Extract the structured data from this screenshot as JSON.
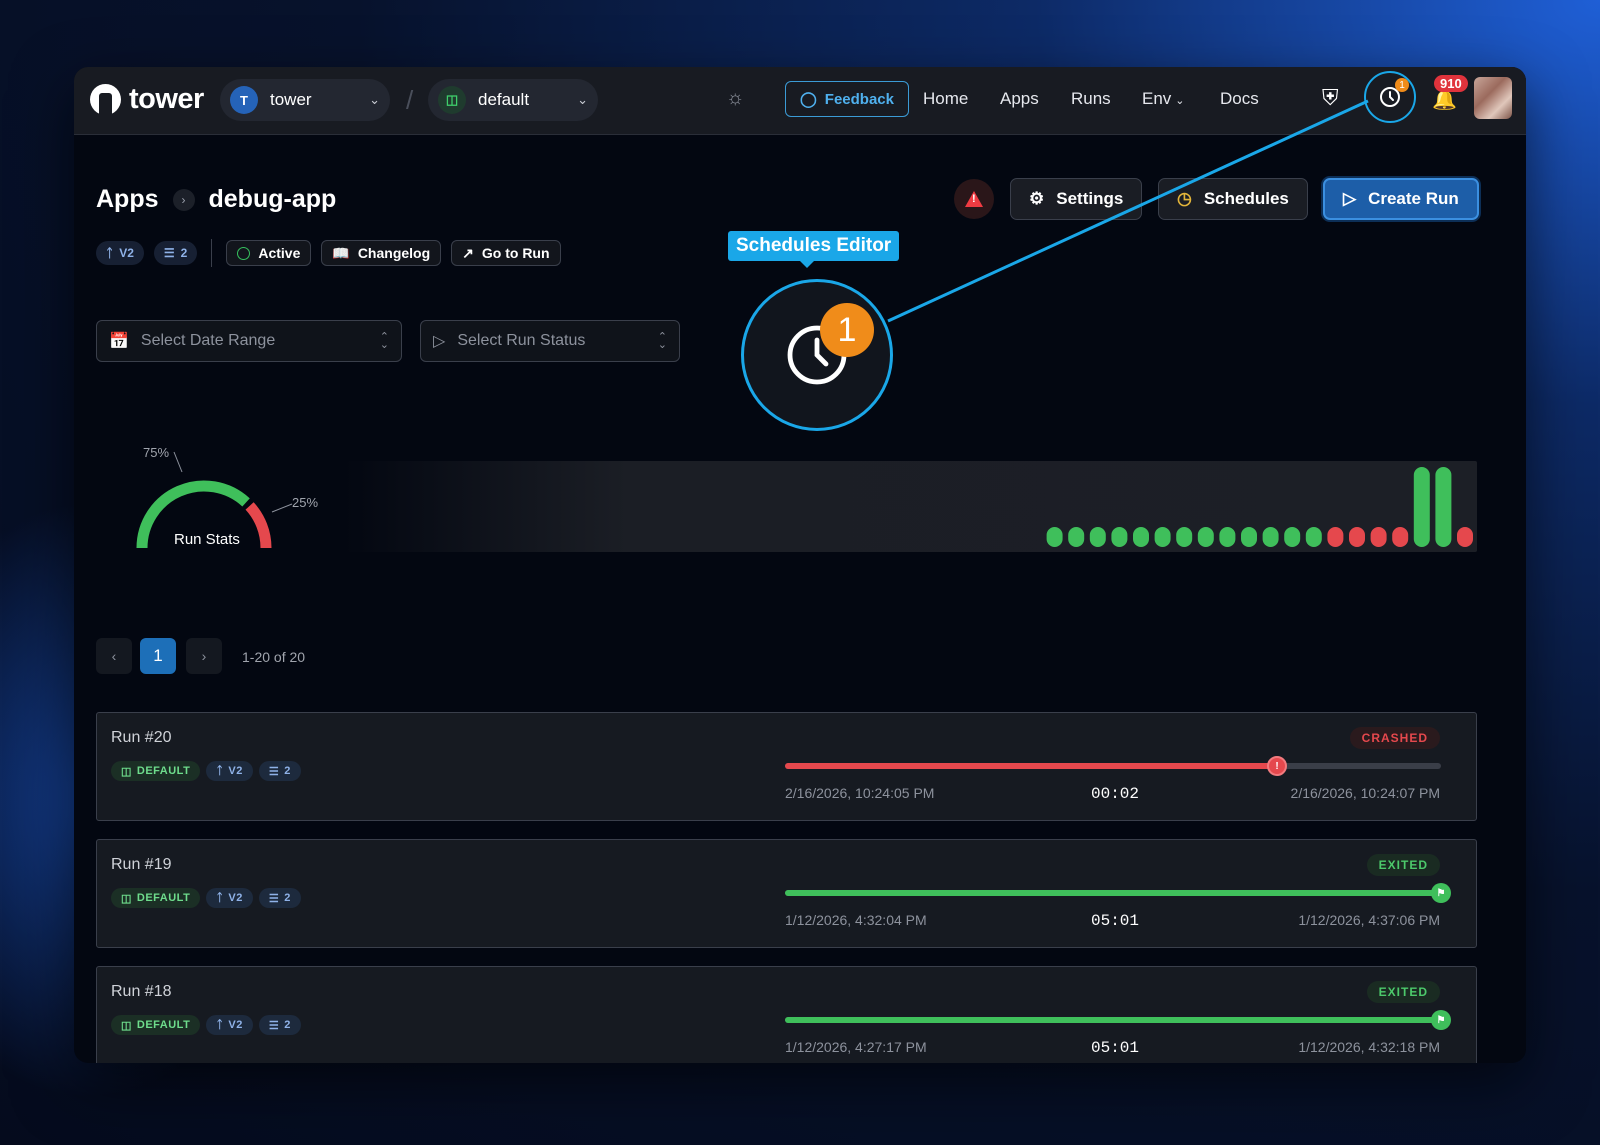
{
  "topbar": {
    "logo_text": "tower",
    "org": {
      "initial": "T",
      "label": "tower"
    },
    "env": {
      "label": "default"
    },
    "feedback_label": "Feedback",
    "nav": [
      {
        "label": "Home"
      },
      {
        "label": "Apps"
      },
      {
        "label": "Runs"
      },
      {
        "label": "Env",
        "has_dropdown": true
      },
      {
        "label": "Docs"
      }
    ],
    "schedules_badge": "1",
    "notifications_count": "910"
  },
  "header": {
    "breadcrumb_root": "Apps",
    "app_name": "debug-app",
    "buttons": {
      "settings": "Settings",
      "schedules": "Schedules",
      "create_run": "Create Run"
    },
    "tags": {
      "version": "V2",
      "params": "2",
      "status": "Active",
      "changelog": "Changelog",
      "go_to_run": "Go to Run"
    }
  },
  "callout": {
    "tooltip": "Schedules Editor",
    "badge": "1"
  },
  "filters": {
    "date_range": "Select Date Range",
    "run_status": "Select Run Status"
  },
  "stats": {
    "title": "Run Stats",
    "success_label": "75%",
    "failure_label": "25%",
    "success_fraction": 0.75,
    "histogram": [
      {
        "status": "success",
        "level": 0.25
      },
      {
        "status": "success",
        "level": 0.25
      },
      {
        "status": "success",
        "level": 0.25
      },
      {
        "status": "success",
        "level": 0.25
      },
      {
        "status": "success",
        "level": 0.25
      },
      {
        "status": "success",
        "level": 0.25
      },
      {
        "status": "success",
        "level": 0.25
      },
      {
        "status": "success",
        "level": 0.25
      },
      {
        "status": "success",
        "level": 0.25
      },
      {
        "status": "success",
        "level": 0.25
      },
      {
        "status": "success",
        "level": 0.25
      },
      {
        "status": "success",
        "level": 0.25
      },
      {
        "status": "success",
        "level": 0.25
      },
      {
        "status": "failure",
        "level": 0.25
      },
      {
        "status": "failure",
        "level": 0.25
      },
      {
        "status": "failure",
        "level": 0.25
      },
      {
        "status": "failure",
        "level": 0.25
      },
      {
        "status": "success",
        "level": 1.0
      },
      {
        "status": "success",
        "level": 1.0
      },
      {
        "status": "failure",
        "level": 0.25
      }
    ],
    "colors": {
      "success": "#3fbf5b",
      "failure": "#e5484d"
    }
  },
  "pagination": {
    "current": "1",
    "range": "1-20 of 20"
  },
  "runs": [
    {
      "title": "Run #20",
      "env": "DEFAULT",
      "version": "V2",
      "params": "2",
      "status": "CRASHED",
      "status_kind": "crashed",
      "start": "2/16/2026, 10:24:05 PM",
      "duration": "00:02",
      "end": "2/16/2026, 10:24:07 PM",
      "progress": 0.75
    },
    {
      "title": "Run #19",
      "env": "DEFAULT",
      "version": "V2",
      "params": "2",
      "status": "EXITED",
      "status_kind": "exited",
      "start": "1/12/2026, 4:32:04 PM",
      "duration": "05:01",
      "end": "1/12/2026, 4:37:06 PM",
      "progress": 1.0
    },
    {
      "title": "Run #18",
      "env": "DEFAULT",
      "version": "V2",
      "params": "2",
      "status": "EXITED",
      "status_kind": "exited",
      "start": "1/12/2026, 4:27:17 PM",
      "duration": "05:01",
      "end": "1/12/2026, 4:32:18 PM",
      "progress": 1.0
    }
  ]
}
